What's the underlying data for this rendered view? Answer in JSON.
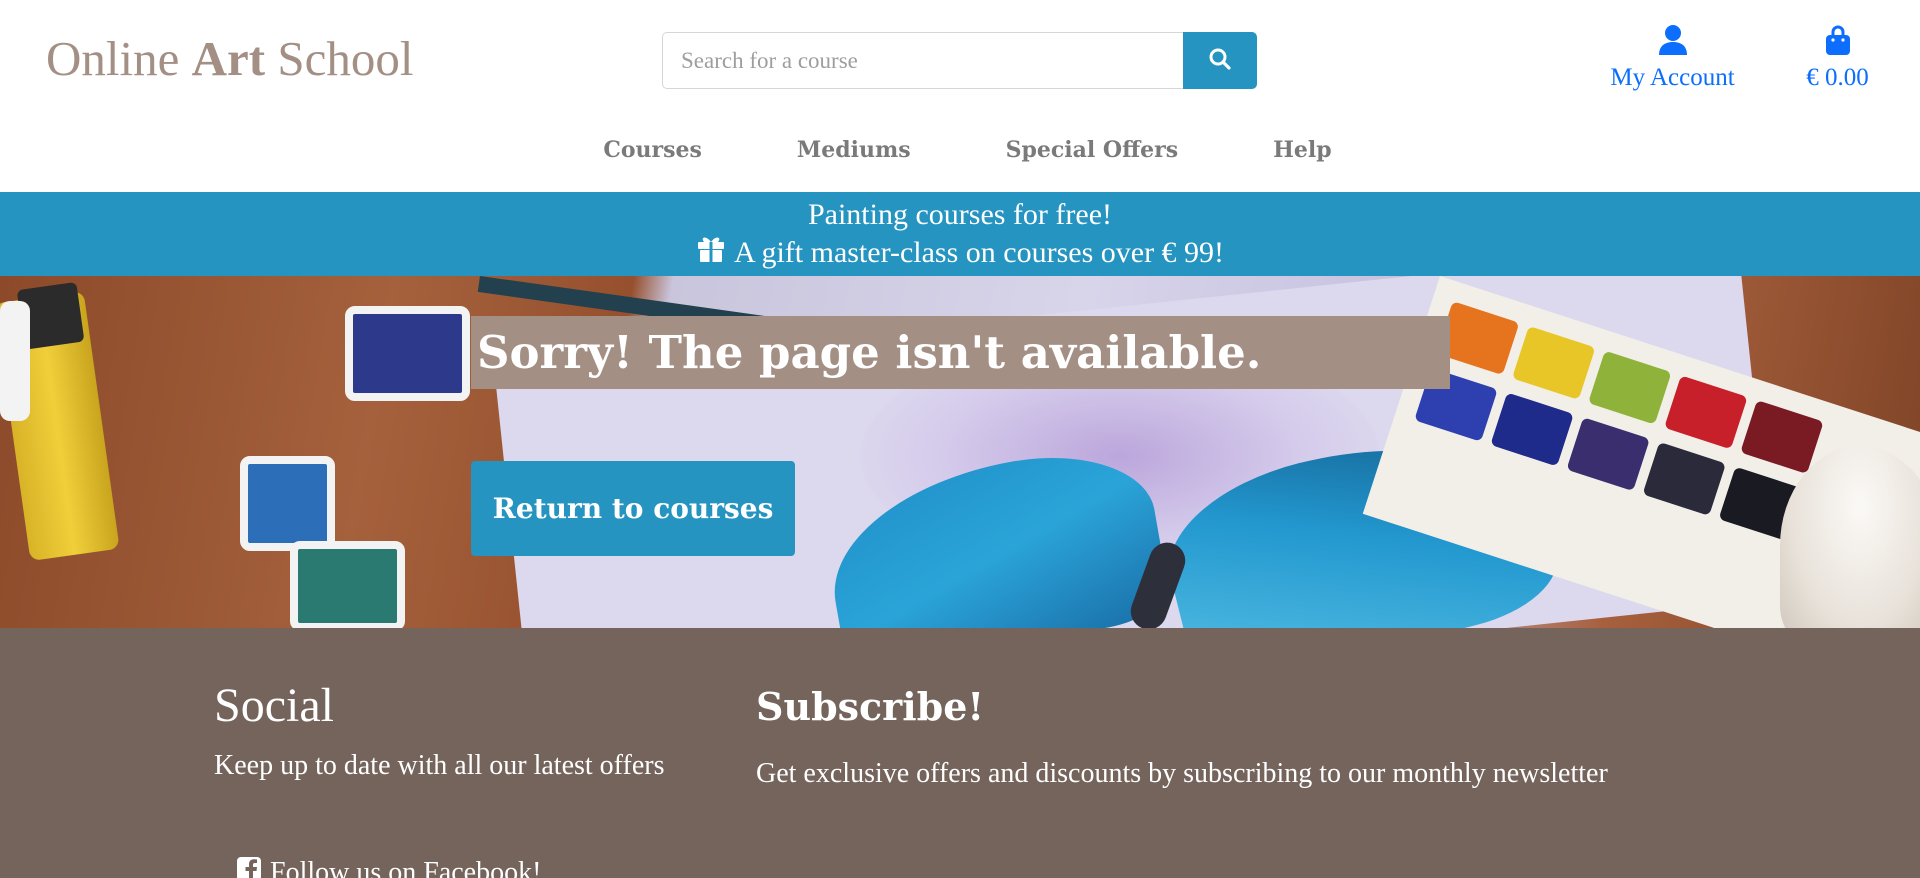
{
  "brand": {
    "logo_prefix": "Online ",
    "logo_bold": "Art",
    "logo_suffix": " School",
    "color": "#a48f85"
  },
  "search": {
    "placeholder": "Search for a course",
    "value": "",
    "button_icon": "search-icon"
  },
  "account": {
    "label": "My Account",
    "icon": "user-icon"
  },
  "cart": {
    "total": "€ 0.00",
    "icon": "shopping-bag-icon"
  },
  "nav": {
    "items": [
      {
        "label": "Courses"
      },
      {
        "label": "Mediums"
      },
      {
        "label": "Special Offers"
      },
      {
        "label": "Help"
      }
    ]
  },
  "promo": {
    "line1": "Painting courses for free!",
    "line2": "A gift master-class on courses over € 99!",
    "icon": "gift-icon"
  },
  "hero": {
    "title": "Sorry! The page isn't available.",
    "button_label": "Return to courses"
  },
  "footer": {
    "social_heading": "Social",
    "social_text": "Keep up to date with all our latest offers",
    "facebook_label": "Follow us on Facebook!",
    "facebook_icon": "facebook-icon",
    "subscribe_heading": "Subscribe!",
    "subscribe_text": "Get exclusive offers and discounts by subscribing to our monthly newsletter"
  },
  "colors": {
    "accent": "#2594c0",
    "link": "#0d6efd",
    "footer_bg": "#74645c",
    "nav_text": "#7a7a7a"
  }
}
